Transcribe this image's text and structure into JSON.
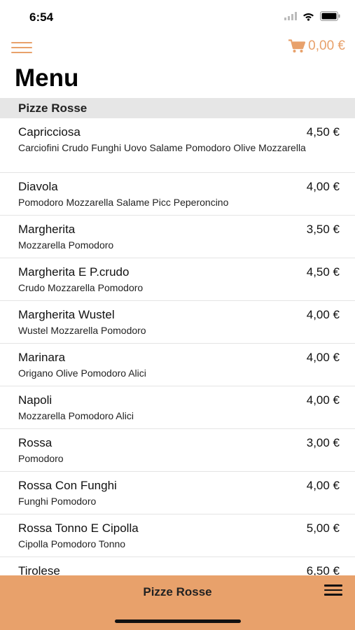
{
  "status": {
    "time": "6:54",
    "icons": [
      "signal-icon",
      "wifi-icon",
      "battery-icon"
    ]
  },
  "header": {
    "cart_total": "0,00 €",
    "title": "Menu"
  },
  "section": {
    "title": "Pizze Rosse"
  },
  "items": [
    {
      "name": "Capricciosa",
      "price": "4,50 €",
      "description": "Carciofini Crudo Funghi Uovo Salame Pomodoro Olive Mozzarella"
    },
    {
      "name": "Diavola",
      "price": "4,00 €",
      "description": "Pomodoro Mozzarella Salame Picc Peperoncino"
    },
    {
      "name": "Margherita",
      "price": "3,50 €",
      "description": "Mozzarella Pomodoro"
    },
    {
      "name": "Margherita E P.crudo",
      "price": "4,50 €",
      "description": "Crudo Mozzarella Pomodoro"
    },
    {
      "name": "Margherita Wustel",
      "price": "4,00 €",
      "description": "Wustel Mozzarella Pomodoro"
    },
    {
      "name": "Marinara",
      "price": "4,00 €",
      "description": "Origano Olive Pomodoro Alici"
    },
    {
      "name": "Napoli",
      "price": "4,00 €",
      "description": "Mozzarella Pomodoro Alici"
    },
    {
      "name": "Rossa",
      "price": "3,00 €",
      "description": "Pomodoro"
    },
    {
      "name": "Rossa Con Funghi",
      "price": "4,00 €",
      "description": "Funghi Pomodoro"
    },
    {
      "name": "Rossa Tonno E Cipolla",
      "price": "5,00 €",
      "description": "Cipolla Pomodoro Tonno"
    },
    {
      "name": "Tirolese",
      "price": "6,50 €",
      "description": ""
    }
  ],
  "bottom_bar": {
    "category": "Pizze Rosse"
  },
  "colors": {
    "accent": "#E8A16B",
    "section_bg": "#E6E6E6"
  }
}
